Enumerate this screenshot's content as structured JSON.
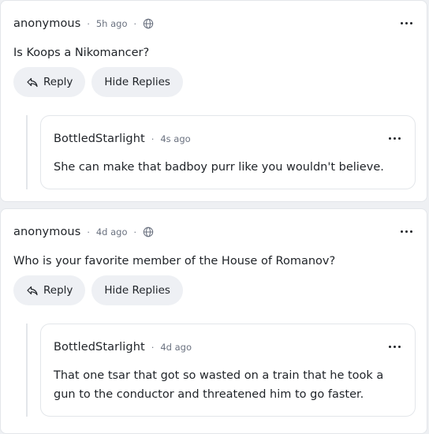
{
  "comments": [
    {
      "author": "anonymous",
      "time": "5h ago",
      "separator": "·",
      "body": "Is Koops a Nikomancer?",
      "reply_label": "Reply",
      "hide_label": "Hide Replies",
      "replies": [
        {
          "author": "BottledStarlight",
          "time": "4s ago",
          "separator": "·",
          "body": "She can make that badboy purr like you wouldn't believe."
        }
      ]
    },
    {
      "author": "anonymous",
      "time": "4d ago",
      "separator": "·",
      "body": "Who is your favorite member of the House of Romanov?",
      "reply_label": "Reply",
      "hide_label": "Hide Replies",
      "replies": [
        {
          "author": "BottledStarlight",
          "time": "4d ago",
          "separator": "·",
          "body": "That one tsar that got so wasted on a train that he took a gun to the conductor and threatened him to go faster."
        }
      ]
    }
  ],
  "icons": {
    "visibility": "globe-icon",
    "more": "more-horizontal-icon",
    "reply": "reply-arrow-icon"
  }
}
